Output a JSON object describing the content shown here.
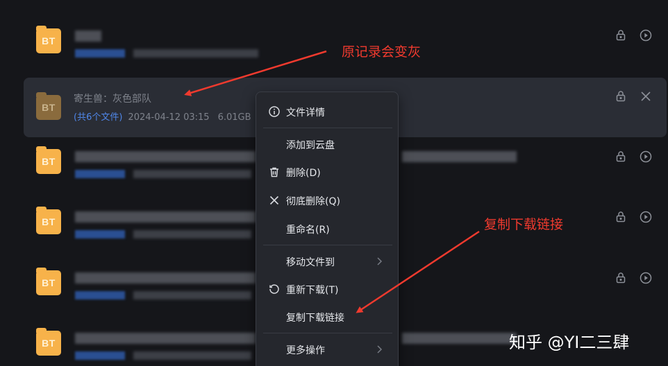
{
  "rows": [
    {
      "id": "row1"
    },
    {
      "id": "row2",
      "folder_label": "BT",
      "title": "寄生兽：灰色部队",
      "file_count": "(共6个文件)",
      "date": "2024-04-12 03:15",
      "size": "6.01GB"
    },
    {
      "id": "row3"
    },
    {
      "id": "row4"
    },
    {
      "id": "row5"
    },
    {
      "id": "row6"
    }
  ],
  "folder_label": "BT",
  "context_menu": {
    "items": [
      {
        "label": "文件详情",
        "icon": "info-icon"
      },
      {
        "label": "添加到云盘",
        "icon": ""
      },
      {
        "label": "删除(D)",
        "icon": "trash-icon"
      },
      {
        "label": "彻底删除(Q)",
        "icon": "close-icon"
      },
      {
        "label": "重命名(R)",
        "icon": ""
      },
      {
        "label": "移动文件到",
        "icon": "",
        "submenu": true
      },
      {
        "label": "重新下载(T)",
        "icon": "refresh-icon"
      },
      {
        "label": "复制下载链接",
        "icon": ""
      },
      {
        "label": "更多操作",
        "icon": "",
        "submenu": true
      }
    ]
  },
  "annotations": {
    "note1": "原记录会变灰",
    "note2": "复制下载链接"
  },
  "watermark": "知乎 @YI二三肆",
  "colors": {
    "annotation": "#f03a2e",
    "folder": "#f7b24a",
    "link_blue": "#4f86e8"
  }
}
